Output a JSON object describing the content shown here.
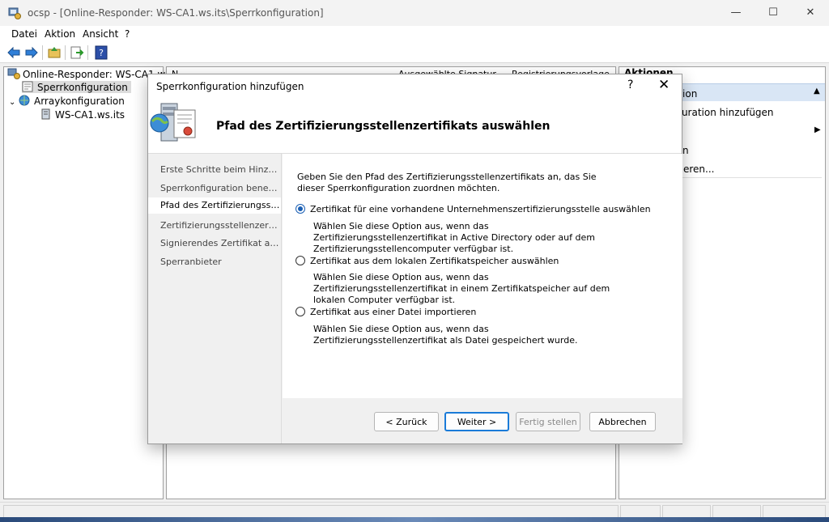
{
  "window": {
    "title": "ocsp - [Online-Responder: WS-CA1.ws.its\\Sperrkonfiguration]",
    "controls": {
      "minimize": "—",
      "maximize": "☐",
      "close": "✕"
    }
  },
  "menu": {
    "items": [
      "Datei",
      "Aktion",
      "Ansicht",
      "?"
    ]
  },
  "tree": {
    "items": [
      {
        "label": "Online-Responder: WS-CA1.ws.its"
      },
      {
        "label": "Sperrkonfiguration"
      },
      {
        "label": "Arraykonfiguration"
      },
      {
        "label": "WS-CA1.ws.its"
      }
    ]
  },
  "list": {
    "headers": [
      "N",
      "Ausgewählte Signatur",
      "Registrierungsvorlage"
    ]
  },
  "actions": {
    "title": "Aktionen",
    "group": "ation",
    "items": [
      "iguration hinzufügen",
      "ren",
      "rtieren..."
    ]
  },
  "dialog": {
    "title": "Sperrkonfiguration hinzufügen",
    "help": "?",
    "close": "✕",
    "heading": "Pfad des Zertifizierungsstellenzertifikats auswählen",
    "steps": [
      "Erste Schritte beim Hinzu...",
      "Sperrkonfiguration benen...",
      "Pfad des Zertifizierungsst...",
      "Zertifizierungsstellenzertif...",
      "Signierendes Zertifikat au...",
      "Sperranbieter"
    ],
    "intro": "Geben Sie den Pfad des Zertifizierungsstellenzertifikats an, das Sie dieser Sperrkonfiguration zuordnen möchten.",
    "options": [
      {
        "label": "Zertifikat für eine vorhandene Unternehmenszertifizierungsstelle auswählen",
        "description": "Wählen Sie diese Option aus, wenn das Zertifizierungsstellenzertifikat in Active Directory oder auf dem Zertifizierungsstellencomputer verfügbar ist.",
        "selected": true
      },
      {
        "label": "Zertifikat aus dem lokalen Zertifikatspeicher auswählen",
        "description": "Wählen Sie diese Option aus, wenn das Zertifizierungsstellenzertifikat in einem Zertifikatspeicher auf dem lokalen Computer verfügbar ist.",
        "selected": false
      },
      {
        "label": "Zertifikat aus einer Datei importieren",
        "description": "Wählen Sie diese Option aus, wenn das Zertifizierungsstellenzertifikat als Datei gespeichert wurde.",
        "selected": false
      }
    ],
    "buttons": {
      "back": "< Zurück",
      "next": "Weiter >",
      "finish": "Fertig stellen",
      "cancel": "Abbrechen"
    }
  },
  "colors": {
    "accent": "#1a7bd8",
    "radio": "#1a5fb4",
    "action_group": "#d9e6f5"
  },
  "icons": [
    "console-icon",
    "back-arrow-icon",
    "forward-arrow-icon",
    "folder-up-icon",
    "export-icon",
    "help-book-icon",
    "responder-icon",
    "revocation-config-icon",
    "array-icon",
    "server-icon",
    "certificate-server-icon",
    "collapse-up-icon",
    "submenu-right-icon"
  ]
}
